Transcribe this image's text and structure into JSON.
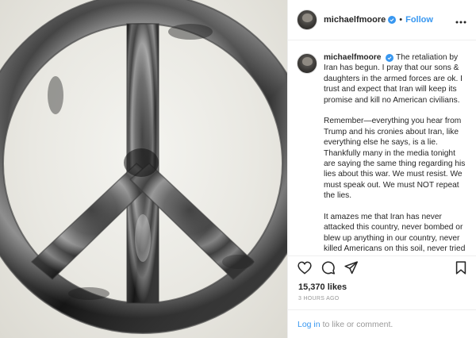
{
  "header": {
    "username": "michaelfmoore",
    "separator": "•",
    "follow_label": "Follow"
  },
  "caption": {
    "username": "michaelfmoore",
    "paragraphs": [
      "The retaliation by Iran has begun. I pray that our sons & daughters in the armed forces are ok. I trust and expect that Iran will keep its promise and kill no American civilians.",
      "Remember—everything you hear from Trump and his cronies about Iran, like everything else he says, is a lie. Thankfully many in the media tonight are saying the same thing regarding his lies about this war. We must resist. We must speak out. We must NOT repeat the lies.",
      "It amazes me that Iran has never attacked this country, never bombed or blew up anything in our country, never killed Americans on this soil, never tried to destroy us."
    ]
  },
  "stats": {
    "likes": "15,370 likes",
    "time": "3 HOURS AGO"
  },
  "login": {
    "link_label": "Log in",
    "rest": "to like or comment."
  },
  "colors": {
    "accent": "#3897f0",
    "verified": "#3897f0"
  },
  "icons": {
    "like": "heart-icon",
    "comment": "comment-icon",
    "share": "share-icon",
    "save": "bookmark-icon",
    "more": "more-options-icon",
    "verified": "verified-badge-icon"
  }
}
